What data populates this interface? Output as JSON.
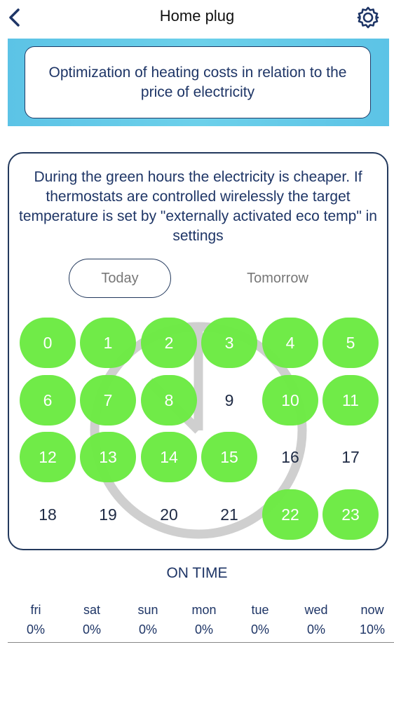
{
  "header": {
    "title": "Home plug",
    "back_icon": "chevron-left-icon",
    "settings_icon": "gear-icon"
  },
  "banner": {
    "text": "Optimization of heating costs in relation to the price of electricity"
  },
  "panel": {
    "description": "During the green hours the electricity is cheaper. If thermostats are controlled wirelessly the target temperature is set by \"externally activated eco temp\" in settings",
    "tabs": [
      {
        "label": "Today",
        "selected": true
      },
      {
        "label": "Tomorrow",
        "selected": false
      }
    ],
    "hours": [
      {
        "label": "0",
        "green": true
      },
      {
        "label": "1",
        "green": true
      },
      {
        "label": "2",
        "green": true
      },
      {
        "label": "3",
        "green": true
      },
      {
        "label": "4",
        "green": true
      },
      {
        "label": "5",
        "green": true
      },
      {
        "label": "6",
        "green": true
      },
      {
        "label": "7",
        "green": true
      },
      {
        "label": "8",
        "green": true
      },
      {
        "label": "9",
        "green": false
      },
      {
        "label": "10",
        "green": true
      },
      {
        "label": "11",
        "green": true
      },
      {
        "label": "12",
        "green": true
      },
      {
        "label": "13",
        "green": true
      },
      {
        "label": "14",
        "green": true
      },
      {
        "label": "15",
        "green": true
      },
      {
        "label": "16",
        "green": false
      },
      {
        "label": "17",
        "green": false
      },
      {
        "label": "18",
        "green": false
      },
      {
        "label": "19",
        "green": false
      },
      {
        "label": "20",
        "green": false
      },
      {
        "label": "21",
        "green": false
      },
      {
        "label": "22",
        "green": true
      },
      {
        "label": "23",
        "green": true
      }
    ]
  },
  "on_time": {
    "title": "ON TIME",
    "days": [
      {
        "day": "fri",
        "percent": "0%"
      },
      {
        "day": "sat",
        "percent": "0%"
      },
      {
        "day": "sun",
        "percent": "0%"
      },
      {
        "day": "mon",
        "percent": "0%"
      },
      {
        "day": "tue",
        "percent": "0%"
      },
      {
        "day": "wed",
        "percent": "0%"
      },
      {
        "day": "now",
        "percent": "10%"
      }
    ]
  },
  "colors": {
    "green": "#6bea42",
    "navy": "#1e3566",
    "banner": "#5cc3e6"
  }
}
